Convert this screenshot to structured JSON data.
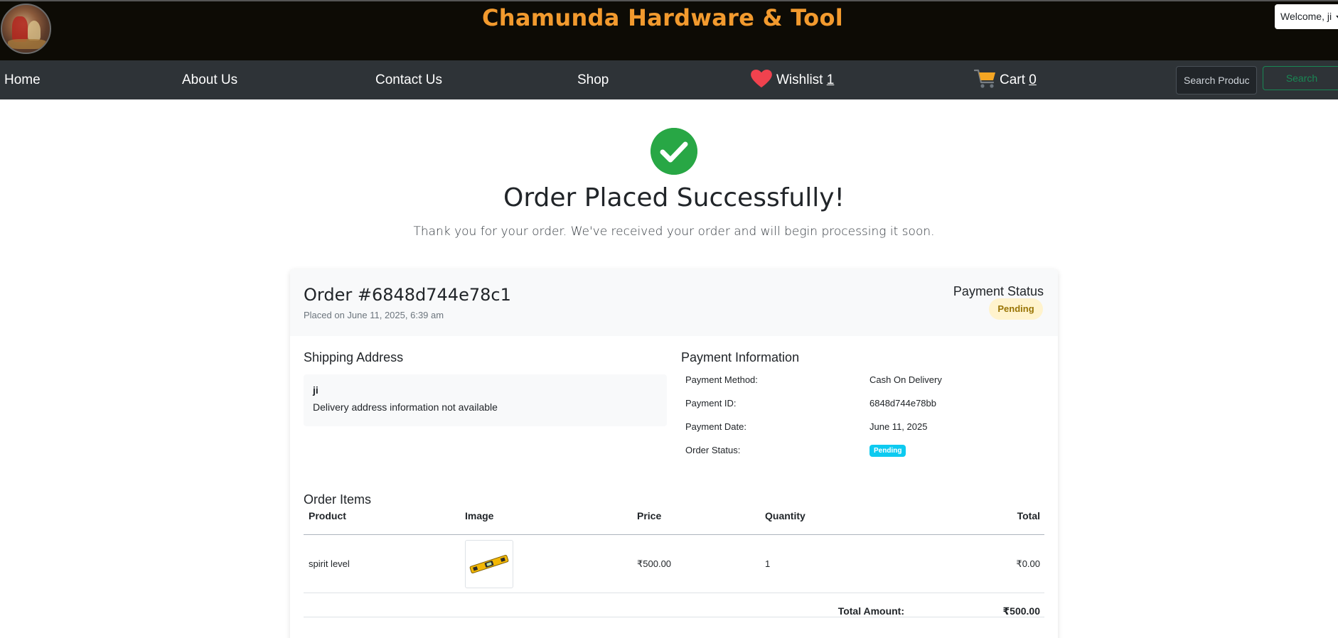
{
  "header": {
    "site_title": "Chamunda Hardware & Tool",
    "welcome": "Welcome, ji"
  },
  "nav": {
    "home": "Home",
    "about": "About Us",
    "contact": "Contact Us",
    "shop": "Shop",
    "wishlist_label": "Wishlist",
    "wishlist_count": "1",
    "cart_label": "Cart",
    "cart_count": "0",
    "search_placeholder": "Search Products",
    "search_button": "Search"
  },
  "success": {
    "title": "Order Placed Successfully!",
    "subtitle": "Thank you for your order. We've received your order and will begin processing it soon."
  },
  "order": {
    "number": "Order #6848d744e78c1",
    "placed_on": "Placed on June 11, 2025, 6:39 am",
    "payment_status_label": "Payment Status",
    "payment_status": "Pending"
  },
  "shipping": {
    "title": "Shipping Address",
    "name": "ji",
    "note": "Delivery address information not available"
  },
  "payment": {
    "title": "Payment Information",
    "rows": [
      {
        "label": "Payment Method:",
        "value": "Cash On Delivery"
      },
      {
        "label": "Payment ID:",
        "value": "6848d744e78bb"
      },
      {
        "label": "Payment Date:",
        "value": "June 11, 2025"
      },
      {
        "label": "Order Status:",
        "value": "Pending"
      }
    ]
  },
  "items": {
    "title": "Order Items",
    "headers": [
      "Product",
      "Image",
      "Price",
      "Quantity",
      "Total"
    ],
    "rows": [
      {
        "product": "spirit level",
        "image_icon": "spirit-level-image",
        "price": "₹500.00",
        "quantity": "1",
        "total": "₹0.00"
      }
    ],
    "total_label": "Total Amount:",
    "total_value": "₹500.00"
  },
  "colors": {
    "header_bg": "#0d0b05",
    "title_orange": "#f29a2e",
    "nav_bg": "#2e3337",
    "success_green": "#28a745",
    "pending_badge_bg": "#fff3cd",
    "status_info": "#0dcaf0"
  }
}
